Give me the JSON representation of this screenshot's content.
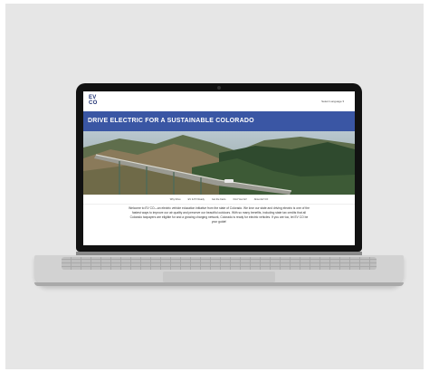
{
  "site": {
    "logo_line1": "EV",
    "logo_line2": "CO",
    "language_selector": "Select Language",
    "hero_title": "DRIVE ELECTRIC FOR A SUSTAINABLE COLORADO",
    "nav": [
      "Why Drive",
      "EV & PV Ready",
      "Get the Facts",
      "Find Your EV",
      "About EV CO"
    ],
    "intro": "Welcome to EV CO—an electric vehicle education initiative from the state of Colorado. We love our state and driving electric is one of the fastest ways to improve our air quality and preserve our beautiful outdoors. With so many benefits, including state tax credits that all Colorado taxpayers are eligible for and a growing charging network, Colorado is ready for electric vehicles. If you are too, let EV CO be your guide!"
  },
  "colors": {
    "brand_blue": "#3a56a4",
    "logo_navy": "#1f3173"
  },
  "icons": {
    "language_chevron": "chevron-down-icon"
  }
}
